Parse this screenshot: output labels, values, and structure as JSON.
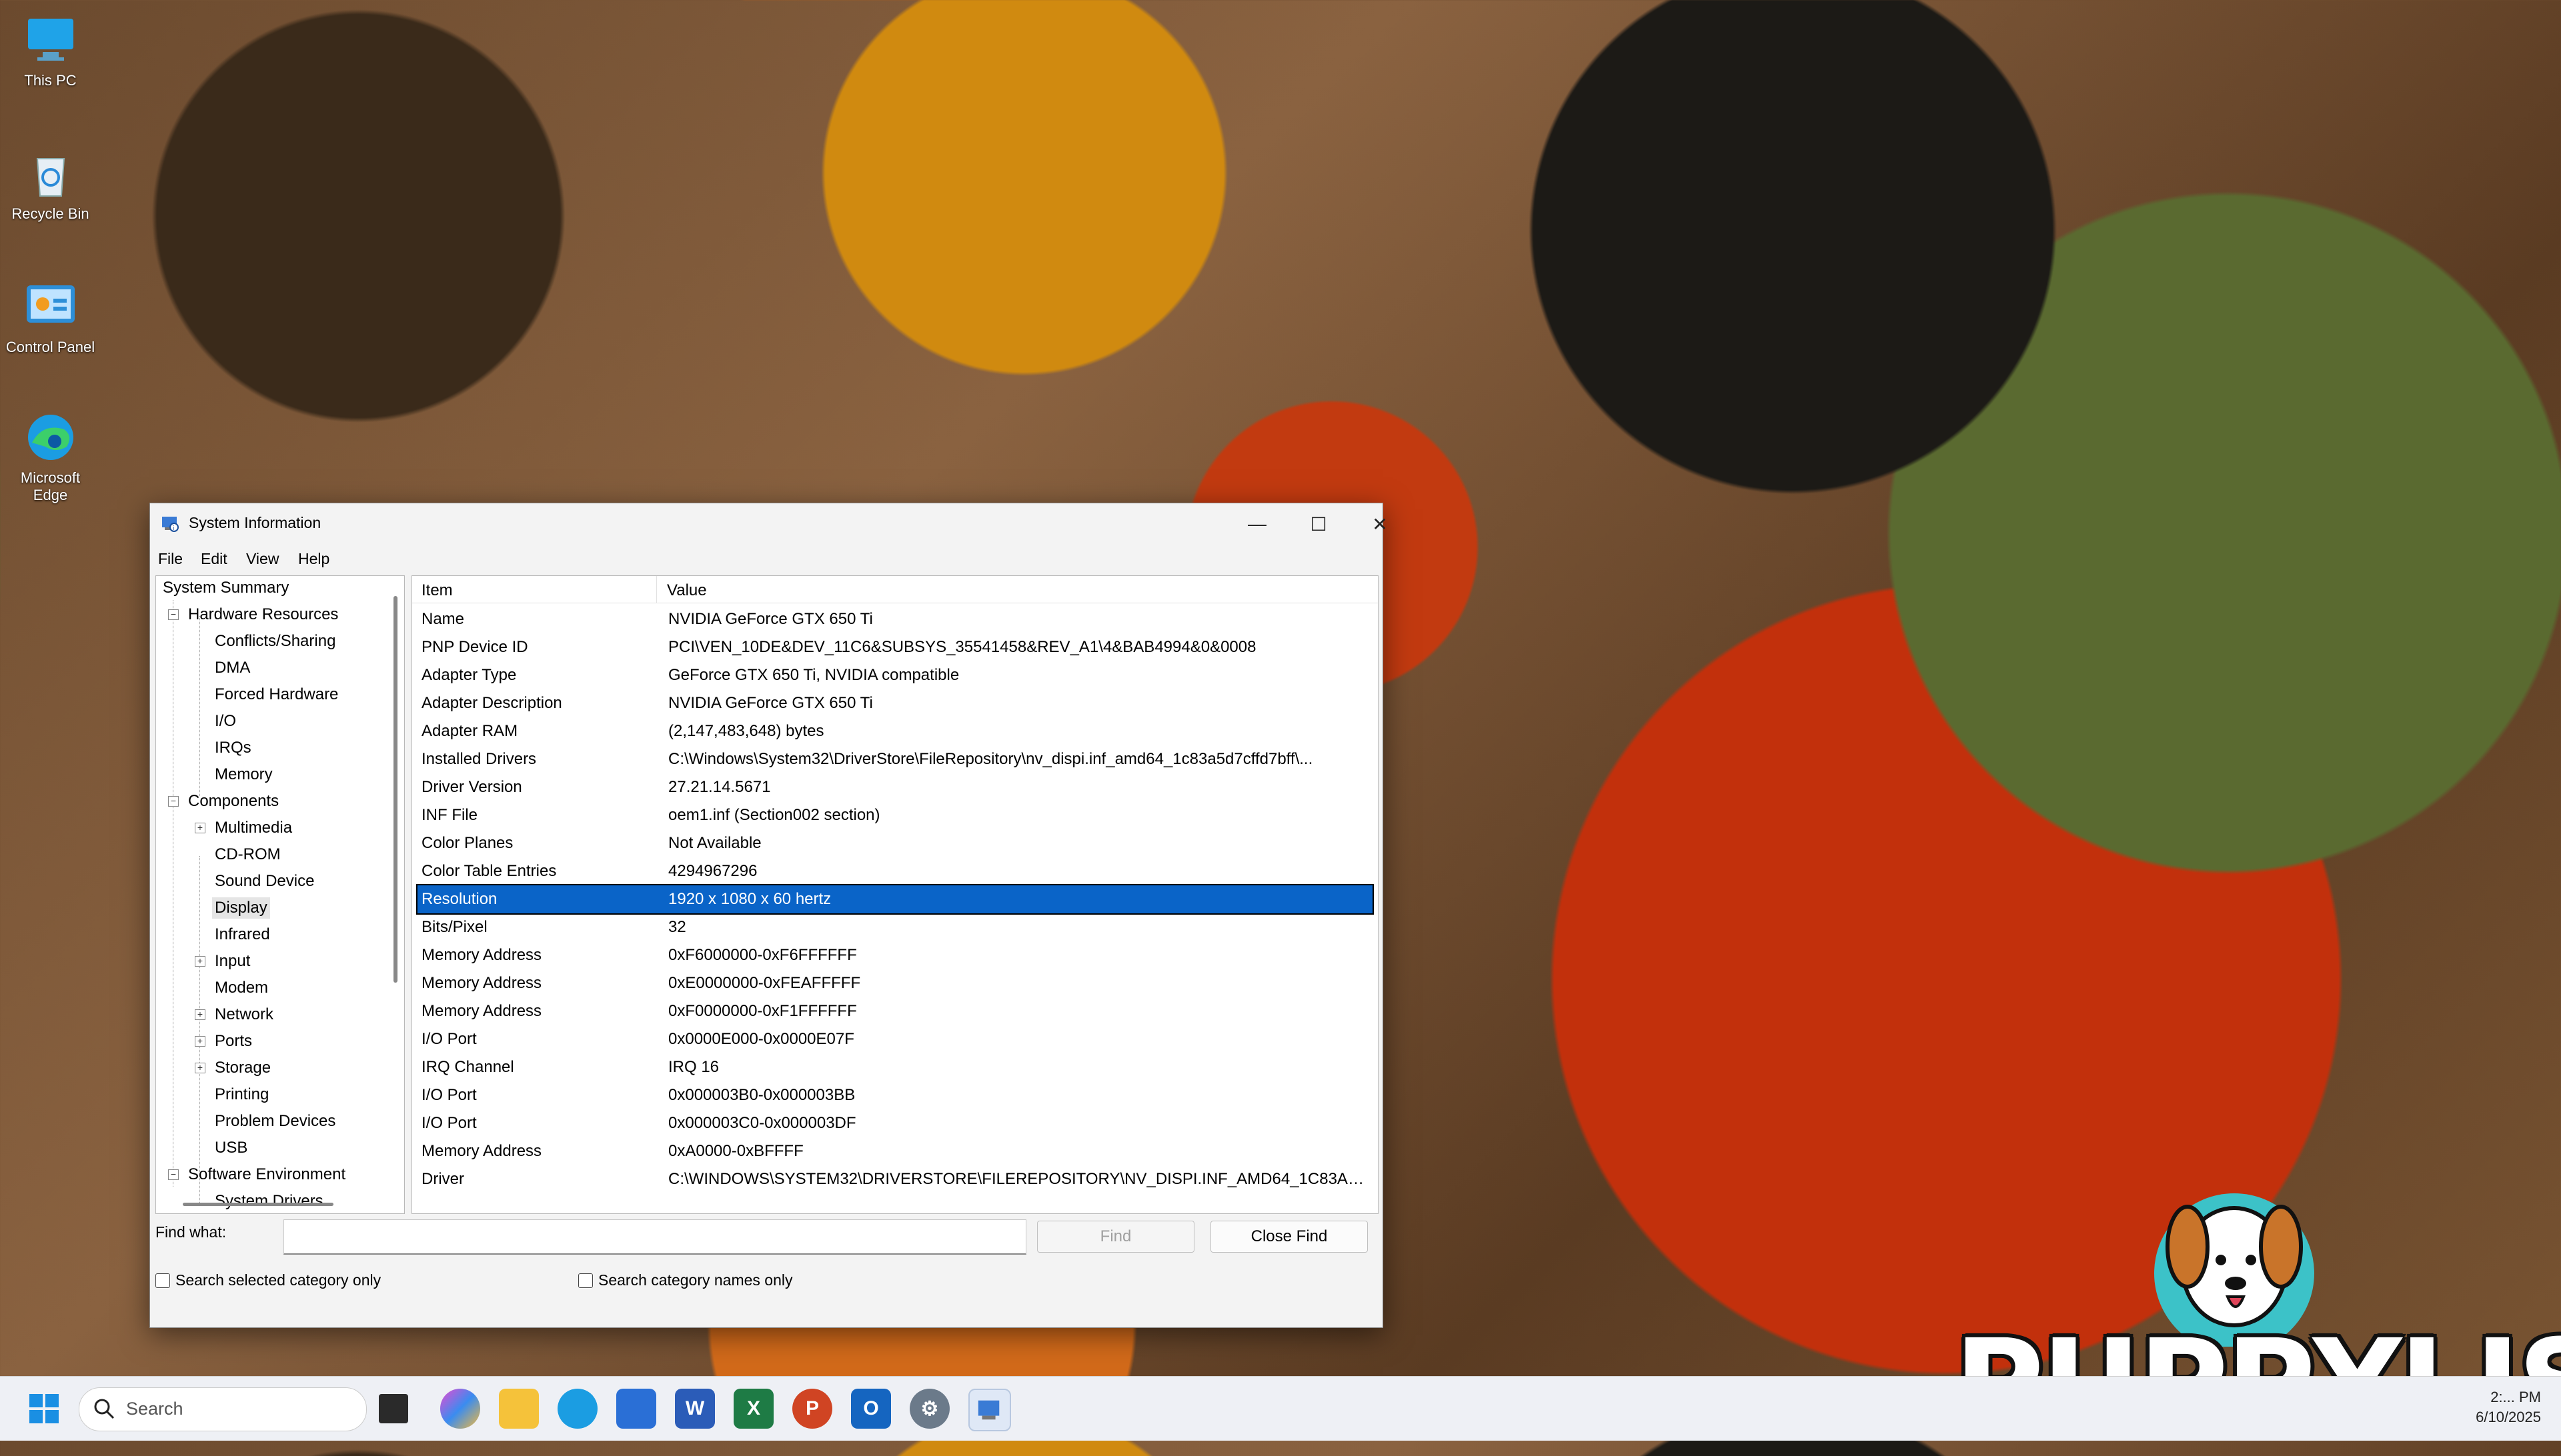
{
  "desktop": {
    "icons": [
      {
        "label": "This PC",
        "icon": "monitor-icon"
      },
      {
        "label": "Recycle Bin",
        "icon": "recycle-bin-icon"
      },
      {
        "label": "Control Panel",
        "icon": "control-panel-icon"
      },
      {
        "label": "Microsoft Edge",
        "icon": "edge-icon"
      }
    ]
  },
  "window": {
    "title": "System Information",
    "menu": [
      "File",
      "Edit",
      "View",
      "Help"
    ],
    "controls": {
      "minimize": "—",
      "maximize": "☐",
      "close": "✕"
    }
  },
  "tree": {
    "root": "System Summary",
    "hardware": "Hardware Resources",
    "hardware_children": [
      "Conflicts/Sharing",
      "DMA",
      "Forced Hardware",
      "I/O",
      "IRQs",
      "Memory"
    ],
    "components": "Components",
    "components_children": [
      {
        "label": "Multimedia",
        "expandable": true
      },
      {
        "label": "CD-ROM",
        "expandable": false
      },
      {
        "label": "Sound Device",
        "expandable": false
      },
      {
        "label": "Display",
        "expandable": false,
        "selected": true
      },
      {
        "label": "Infrared",
        "expandable": false
      },
      {
        "label": "Input",
        "expandable": true
      },
      {
        "label": "Modem",
        "expandable": false
      },
      {
        "label": "Network",
        "expandable": true
      },
      {
        "label": "Ports",
        "expandable": true
      },
      {
        "label": "Storage",
        "expandable": true
      },
      {
        "label": "Printing",
        "expandable": false
      },
      {
        "label": "Problem Devices",
        "expandable": false
      },
      {
        "label": "USB",
        "expandable": false
      }
    ],
    "software": "Software Environment",
    "software_children": [
      "System Drivers"
    ]
  },
  "grid": {
    "headers": {
      "item": "Item",
      "value": "Value"
    },
    "rows": [
      {
        "item": "Name",
        "value": "NVIDIA GeForce GTX 650 Ti"
      },
      {
        "item": "PNP Device ID",
        "value": "PCI\\VEN_10DE&DEV_11C6&SUBSYS_35541458&REV_A1\\4&BAB4994&0&0008"
      },
      {
        "item": "Adapter Type",
        "value": "GeForce GTX 650 Ti, NVIDIA compatible"
      },
      {
        "item": "Adapter Description",
        "value": "NVIDIA GeForce GTX 650 Ti"
      },
      {
        "item": "Adapter RAM",
        "value": "(2,147,483,648) bytes"
      },
      {
        "item": "Installed Drivers",
        "value": "C:\\Windows\\System32\\DriverStore\\FileRepository\\nv_dispi.inf_amd64_1c83a5d7cffd7bff\\..."
      },
      {
        "item": "Driver Version",
        "value": "27.21.14.5671"
      },
      {
        "item": "INF File",
        "value": "oem1.inf (Section002 section)"
      },
      {
        "item": "Color Planes",
        "value": "Not Available"
      },
      {
        "item": "Color Table Entries",
        "value": "4294967296"
      },
      {
        "item": "Resolution",
        "value": "1920 x 1080 x 60 hertz",
        "selected": true
      },
      {
        "item": "Bits/Pixel",
        "value": "32"
      },
      {
        "item": "Memory Address",
        "value": "0xF6000000-0xF6FFFFFF"
      },
      {
        "item": "Memory Address",
        "value": "0xE0000000-0xFEAFFFFF"
      },
      {
        "item": "Memory Address",
        "value": "0xF0000000-0xF1FFFFFF"
      },
      {
        "item": "I/O Port",
        "value": "0x0000E000-0x0000E07F"
      },
      {
        "item": "IRQ Channel",
        "value": "IRQ 16"
      },
      {
        "item": "I/O Port",
        "value": "0x000003B0-0x000003BB"
      },
      {
        "item": "I/O Port",
        "value": "0x000003C0-0x000003DF"
      },
      {
        "item": "Memory Address",
        "value": "0xA0000-0xBFFFF"
      },
      {
        "item": "Driver",
        "value": "C:\\WINDOWS\\SYSTEM32\\DRIVERSTORE\\FILEREPOSITORY\\NV_DISPI.INF_AMD64_1C83A5..."
      }
    ]
  },
  "find": {
    "label": "Find what:",
    "value": "",
    "find_button": "Find",
    "close_button": "Close Find",
    "check_selected": "Search selected category only",
    "check_names": "Search category names only"
  },
  "taskbar": {
    "search_placeholder": "Search",
    "apps": [
      "start-icon",
      "task-view-icon",
      "copilot-icon",
      "file-explorer-icon",
      "edge-icon",
      "store-icon",
      "word-icon",
      "excel-icon",
      "powerpoint-icon",
      "outlook-icon",
      "settings-icon",
      "system-information-icon"
    ],
    "clock_time": "2:... PM",
    "clock_date": "6/10/2025"
  },
  "watermark": {
    "text": "PUPPYLIST"
  }
}
